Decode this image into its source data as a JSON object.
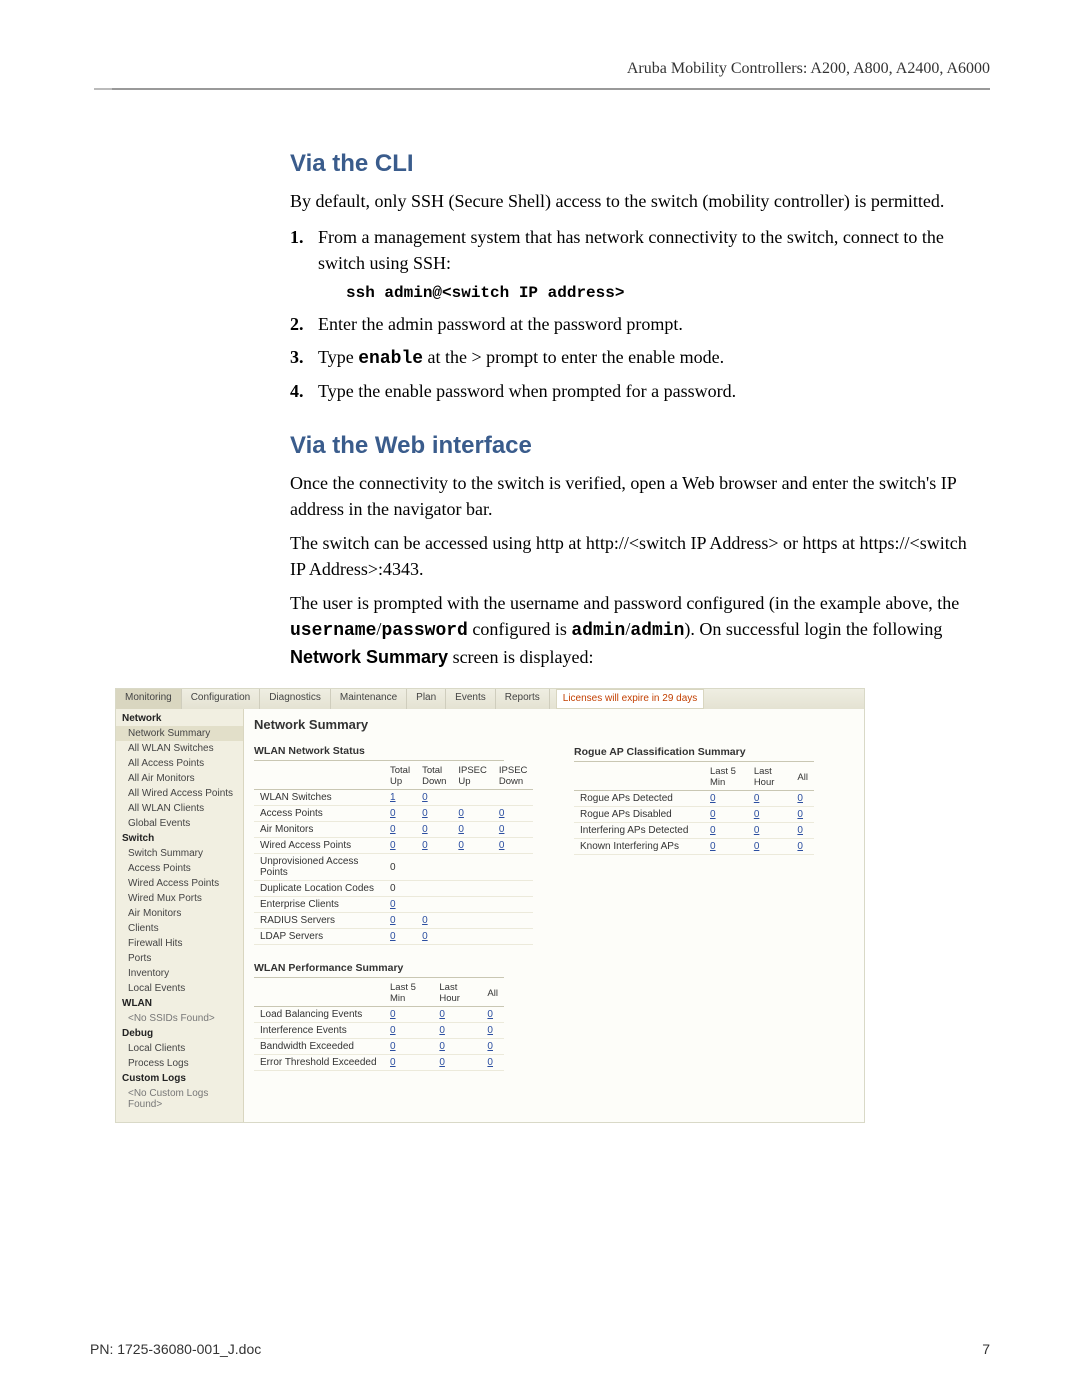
{
  "header": "Aruba Mobility Controllers: A200, A800, A2400, A6000",
  "section_cli": {
    "title": "Via the CLI",
    "intro": "By default, only SSH (Secure Shell) access to the switch (mobility controller) is permitted.",
    "step1": "From a management system that has network connectivity to the switch, connect to the switch using SSH:",
    "cmd_prefix": "ssh admin@",
    "cmd_arg": "<switch IP address>",
    "step2": "Enter the admin password at the password prompt.",
    "step3_a": "Type ",
    "step3_cmd": "enable",
    "step3_b": " at the  > prompt to enter the enable mode.",
    "step4": "Type the enable password when prompted for a password."
  },
  "section_web": {
    "title": "Via the Web interface",
    "p1": "Once the connectivity to the switch is verified, open a Web browser and enter the switch's IP address in the navigator bar.",
    "p2": "The switch can be accessed using http at http://<switch IP Address> or https at https://<switch IP Address>:4343.",
    "p3a": "The user is prompted with the username and password configured (in the example above, the ",
    "p3b": "username",
    "p3c": "/",
    "p3d": "password",
    "p3e": " configured is ",
    "p3f": "admin",
    "p3g": "/",
    "p3h": "admin",
    "p3i": "). On successful login the following ",
    "p3j": "Network Summary",
    "p3k": " screen is displayed:"
  },
  "ui": {
    "tabs": [
      "Monitoring",
      "Configuration",
      "Diagnostics",
      "Maintenance",
      "Plan",
      "Events",
      "Reports"
    ],
    "license_msg": "Licenses will expire in 29 days",
    "nav": {
      "groups": [
        {
          "h": "Network",
          "items": [
            "Network Summary",
            "All WLAN Switches",
            "All Access Points",
            "All Air Monitors",
            "All Wired Access Points",
            "All WLAN Clients",
            "Global Events"
          ],
          "sel": 0
        },
        {
          "h": "Switch",
          "items": [
            "Switch Summary",
            "Access Points",
            "Wired Access Points",
            "Wired Mux Ports",
            "Air Monitors",
            "Clients",
            "Firewall Hits",
            "Ports",
            "Inventory",
            "Local Events"
          ]
        },
        {
          "h": "WLAN",
          "items": [
            "<No SSIDs Found>"
          ]
        },
        {
          "h": "Debug",
          "items": [
            "Local Clients",
            "Process Logs"
          ]
        },
        {
          "h": "Custom Logs",
          "items": [
            "<No Custom Logs Found>"
          ]
        }
      ]
    },
    "main_title": "Network Summary",
    "status": {
      "title": "WLAN Network Status",
      "cols": [
        "",
        "Total Up",
        "Total Down",
        "IPSEC Up",
        "IPSEC Down"
      ],
      "rows": [
        {
          "l": "WLAN Switches",
          "v": [
            "1",
            "0",
            "",
            ""
          ]
        },
        {
          "l": "Access Points",
          "v": [
            "0",
            "0",
            "0",
            "0"
          ]
        },
        {
          "l": "Air Monitors",
          "v": [
            "0",
            "0",
            "0",
            "0"
          ]
        },
        {
          "l": "Wired Access Points",
          "v": [
            "0",
            "0",
            "0",
            "0"
          ]
        },
        {
          "l": "Unprovisioned Access Points",
          "v": [
            "0",
            "",
            "",
            ""
          ],
          "plain": true
        },
        {
          "l": "Duplicate Location Codes",
          "v": [
            "0",
            "",
            "",
            ""
          ],
          "plain": true
        },
        {
          "l": "Enterprise Clients",
          "v": [
            "0",
            "",
            "",
            ""
          ]
        },
        {
          "l": "RADIUS Servers",
          "v": [
            "0",
            "0",
            "",
            ""
          ]
        },
        {
          "l": "LDAP Servers",
          "v": [
            "0",
            "0",
            "",
            ""
          ]
        }
      ]
    },
    "perf": {
      "title": "WLAN Performance Summary",
      "cols": [
        "",
        "Last 5 Min",
        "Last Hour",
        "All"
      ],
      "rows": [
        {
          "l": "Load Balancing Events",
          "v": [
            "0",
            "0",
            "0"
          ]
        },
        {
          "l": "Interference Events",
          "v": [
            "0",
            "0",
            "0"
          ]
        },
        {
          "l": "Bandwidth Exceeded",
          "v": [
            "0",
            "0",
            "0"
          ]
        },
        {
          "l": "Error Threshold Exceeded",
          "v": [
            "0",
            "0",
            "0"
          ]
        }
      ]
    },
    "rogue": {
      "title": "Rogue AP Classification Summary",
      "cols": [
        "",
        "Last 5 Min",
        "Last Hour",
        "All"
      ],
      "rows": [
        {
          "l": "Rogue APs Detected",
          "v": [
            "0",
            "0",
            "0"
          ]
        },
        {
          "l": "Rogue APs Disabled",
          "v": [
            "0",
            "0",
            "0"
          ]
        },
        {
          "l": "Interfering APs Detected",
          "v": [
            "0",
            "0",
            "0"
          ]
        },
        {
          "l": "Known Interfering APs",
          "v": [
            "0",
            "0",
            "0"
          ]
        }
      ]
    }
  },
  "footer": {
    "left": "PN: 1725-36080-001_J.doc",
    "right": "7"
  }
}
